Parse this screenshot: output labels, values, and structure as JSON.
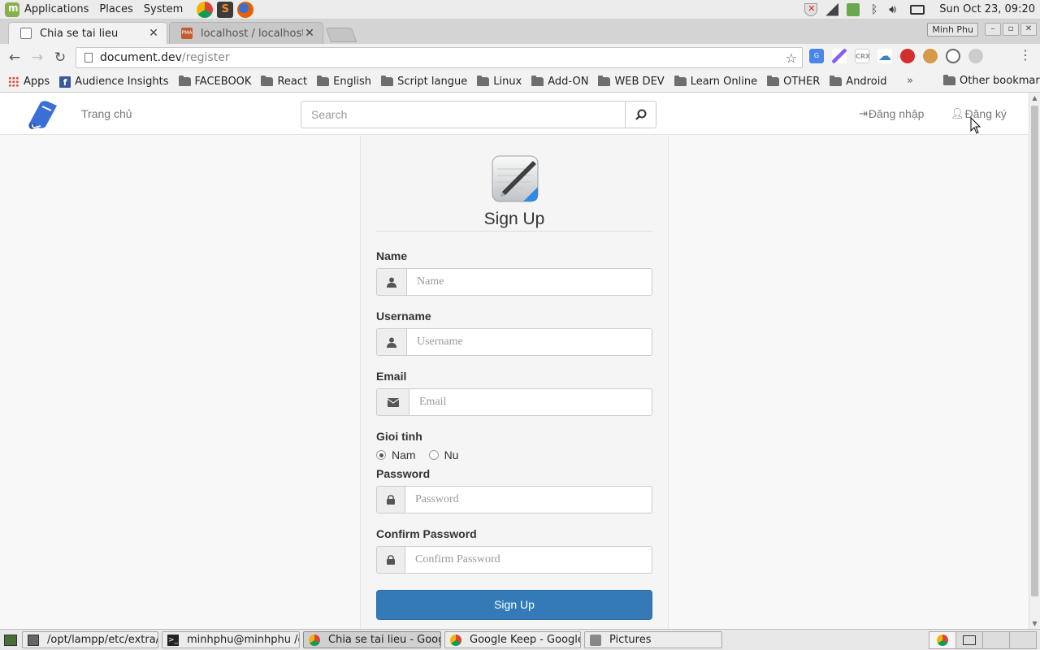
{
  "os_panel": {
    "menus": [
      "Applications",
      "Places",
      "System"
    ],
    "clock": "Sun Oct 23, 09:20"
  },
  "browser": {
    "tabs": [
      {
        "title": "Chia se tai lieu",
        "active": true
      },
      {
        "title": "localhost / localhost / la",
        "active": false
      }
    ],
    "profile_name": "Minh Phu",
    "url_host": "document.dev",
    "url_path": "/register",
    "extension_crx_label": "CRX",
    "bookmarks": [
      "Apps",
      "Audience Insights",
      "FACEBOOK",
      "React",
      "English",
      "Script langue",
      "Linux",
      "Add-ON",
      "WEB DEV",
      "Learn Online",
      "OTHER",
      "Android"
    ],
    "overflow": "»",
    "other_bookmarks": "Other bookmarks"
  },
  "site": {
    "nav_home": "Trang chủ",
    "search_placeholder": "Search",
    "login": "Đăng nhập",
    "register": "Đăng ký"
  },
  "signup": {
    "title": "Sign Up",
    "name_label": "Name",
    "name_placeholder": "Name",
    "username_label": "Username",
    "username_placeholder": "Username",
    "email_label": "Email",
    "email_placeholder": "Email",
    "gender_label": "Gioi tinh",
    "gender_male": "Nam",
    "gender_female": "Nu",
    "gender_selected": "Nam",
    "password_label": "Password",
    "password_placeholder": "Password",
    "confirm_label": "Confirm Password",
    "confirm_placeholder": "Confirm Password",
    "button": "Sign Up"
  },
  "taskbar": {
    "tasks": [
      {
        "title": "/opt/lampp/etc/extra/...",
        "active": false
      },
      {
        "title": "minhphu@minhphu /o...",
        "active": false
      },
      {
        "title": "Chia se tai lieu - Goog...",
        "active": true
      },
      {
        "title": "Google Keep - Google...",
        "active": false
      },
      {
        "title": "Pictures",
        "active": false
      }
    ]
  },
  "colors": {
    "primary": "#337ab7",
    "logo_blue": "#3b6fd6",
    "page_bg": "#f8f8f8"
  }
}
